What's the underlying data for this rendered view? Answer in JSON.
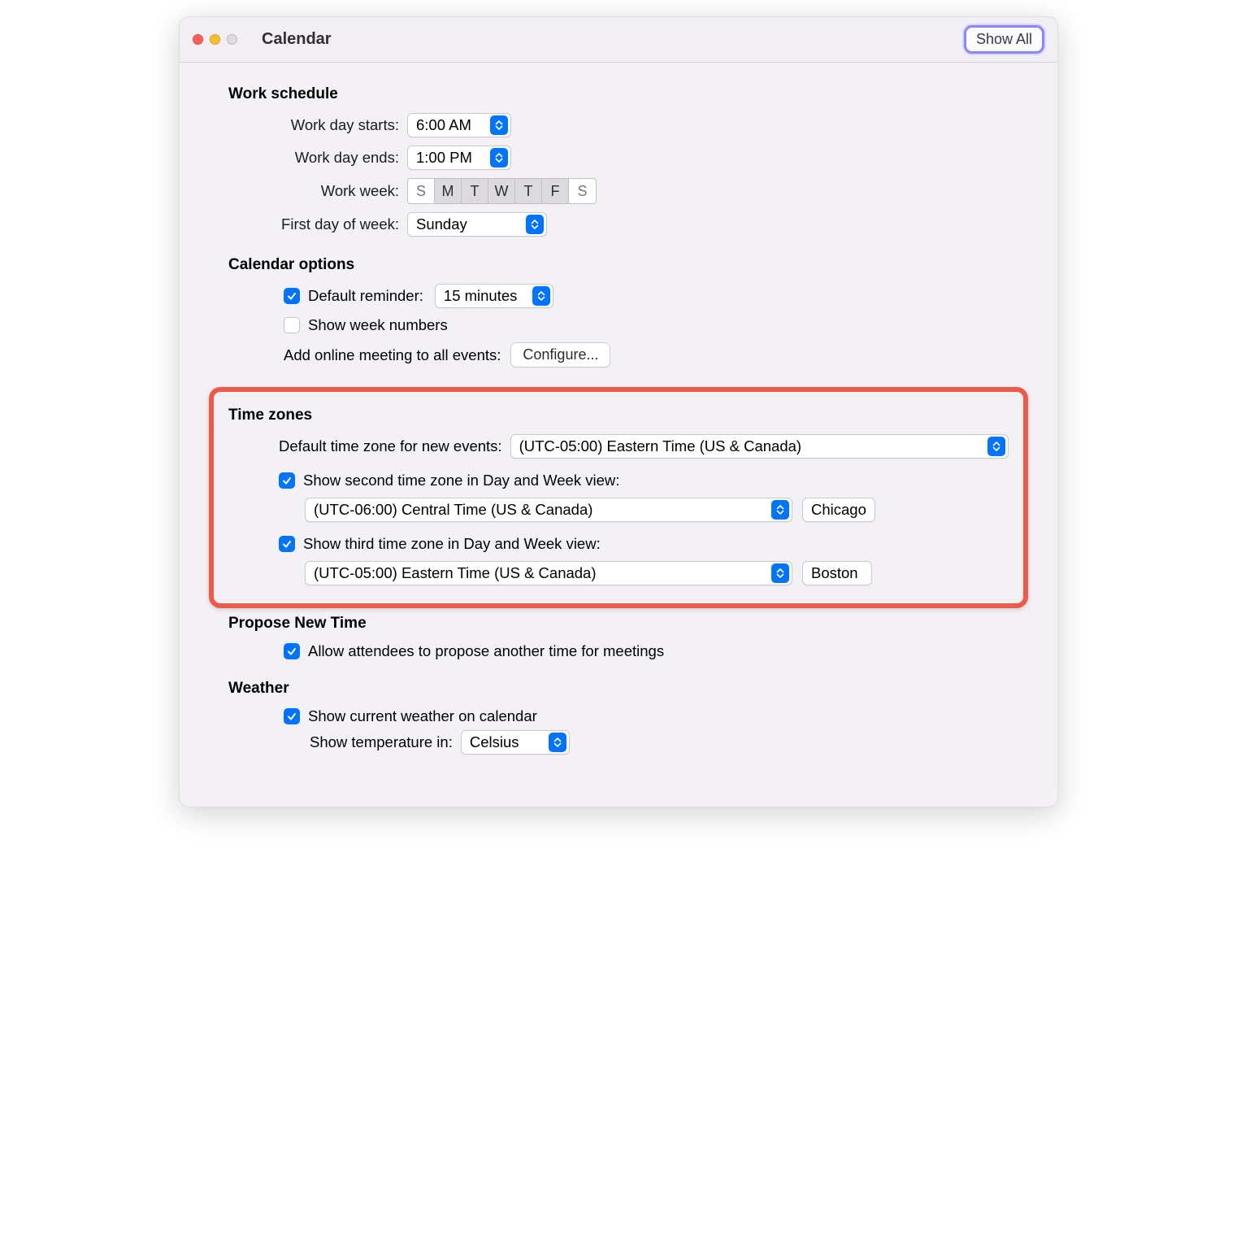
{
  "titlebar": {
    "title": "Calendar",
    "show_all_label": "Show All"
  },
  "work_schedule": {
    "heading": "Work schedule",
    "starts_label": "Work day starts:",
    "starts_value": "6:00 AM",
    "ends_label": "Work day ends:",
    "ends_value": "1:00 PM",
    "work_week_label": "Work week:",
    "days": [
      "S",
      "M",
      "T",
      "W",
      "T",
      "F",
      "S"
    ],
    "days_selected": [
      false,
      true,
      true,
      true,
      true,
      true,
      false
    ],
    "first_day_label": "First day of week:",
    "first_day_value": "Sunday"
  },
  "calendar_options": {
    "heading": "Calendar options",
    "default_reminder_label": "Default reminder:",
    "default_reminder_checked": true,
    "default_reminder_value": "15 minutes",
    "show_week_numbers_label": "Show week numbers",
    "show_week_numbers_checked": false,
    "add_online_meeting_label": "Add online meeting to all events:",
    "configure_label": "Configure..."
  },
  "time_zones": {
    "heading": "Time zones",
    "default_label": "Default time zone for new events:",
    "default_value": "(UTC-05:00) Eastern Time (US & Canada)",
    "second_checked": true,
    "second_label": "Show second time zone in Day and Week view:",
    "second_value": "(UTC-06:00) Central Time (US & Canada)",
    "second_name": "Chicago",
    "third_checked": true,
    "third_label": "Show third time zone in Day and Week view:",
    "third_value": "(UTC-05:00) Eastern Time (US & Canada)",
    "third_name": "Boston"
  },
  "propose": {
    "heading": "Propose New Time",
    "allow_checked": true,
    "allow_label": "Allow attendees to propose another time for meetings"
  },
  "weather": {
    "heading": "Weather",
    "show_checked": true,
    "show_label": "Show current weather on calendar",
    "temp_label": "Show temperature in:",
    "temp_value": "Celsius"
  }
}
